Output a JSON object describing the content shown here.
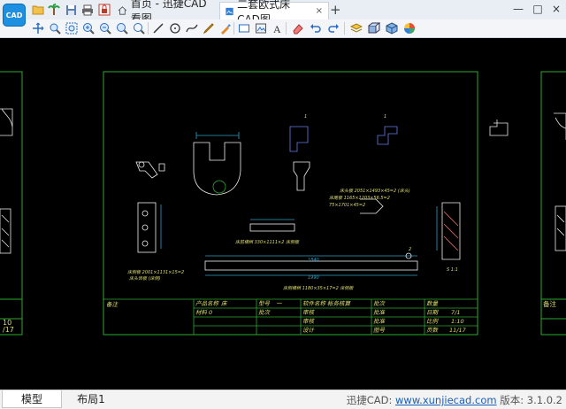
{
  "app": {
    "logo_text": "CAD"
  },
  "quick_icons": [
    "open-folder-icon",
    "palm-tree-icon",
    "save-icon",
    "print-icon",
    "lock-icon"
  ],
  "tabs": [
    {
      "label": "首页 - 迅捷CAD看图",
      "icon": "home-icon"
    },
    {
      "label": "二套欧式床CAD图...",
      "icon": "drawing-file-icon",
      "close": "×"
    }
  ],
  "new_tab": "+",
  "window": {
    "minimize": "—",
    "maximize": "□",
    "close": "×"
  },
  "toolbar": {
    "tools": [
      "zoom-pan-icon",
      "zoom-realtime-icon",
      "zoom-window-icon",
      "zoom-extents-icon",
      "zoom-in-icon",
      "zoom-out-icon",
      "zoom-previous-icon",
      "line-icon",
      "circle-icon",
      "polyline-icon",
      "pencil-icon",
      "annotate-icon",
      "rectangle-icon",
      "image-icon",
      "text-icon",
      "eraser-icon",
      "undo-icon",
      "redo-icon",
      "layer-icon",
      "3d-view-icon",
      "cube-icon",
      "color-wheel-icon"
    ]
  },
  "bottom": {
    "tab_model": "模型",
    "tab_layout": "布局1",
    "status_prefix": "迅捷CAD:",
    "status_link": "www.xunjiecad.com",
    "status_version": "版本: 3.1.0.2"
  },
  "drawing": {
    "title_block": {
      "r1": [
        "备注",
        "产品名称",
        "床",
        "型号",
        "一",
        "软件名称",
        "帐务核算",
        "批次",
        "数量"
      ],
      "r2": [
        "材料",
        "0",
        "批次",
        "审核",
        "批准",
        "日期",
        "7/1"
      ],
      "r3": [
        "",
        "审核",
        "批准",
        "比例",
        "1:10"
      ],
      "r4": [
        "设计",
        "图号",
        "页数",
        "11/17"
      ]
    },
    "side_labels": {
      "left_a": "10",
      "left_b": "/17",
      "right_a": "备注"
    },
    "notes": [
      "床头板  2051×1493×45=2  (床头)",
      "床尾板 1165×1203×56.5=2",
      "75×1701×45=2",
      "床侧板  2001×1131×15=2",
      "床头饰板 (床侧)",
      "床前横档 330×1111×2  床侧板",
      "床侧横档 1180×35×17=2  床侧板",
      "S 1:1"
    ],
    "dims": [
      "1840",
      "1990",
      "2",
      "1",
      "1"
    ]
  }
}
